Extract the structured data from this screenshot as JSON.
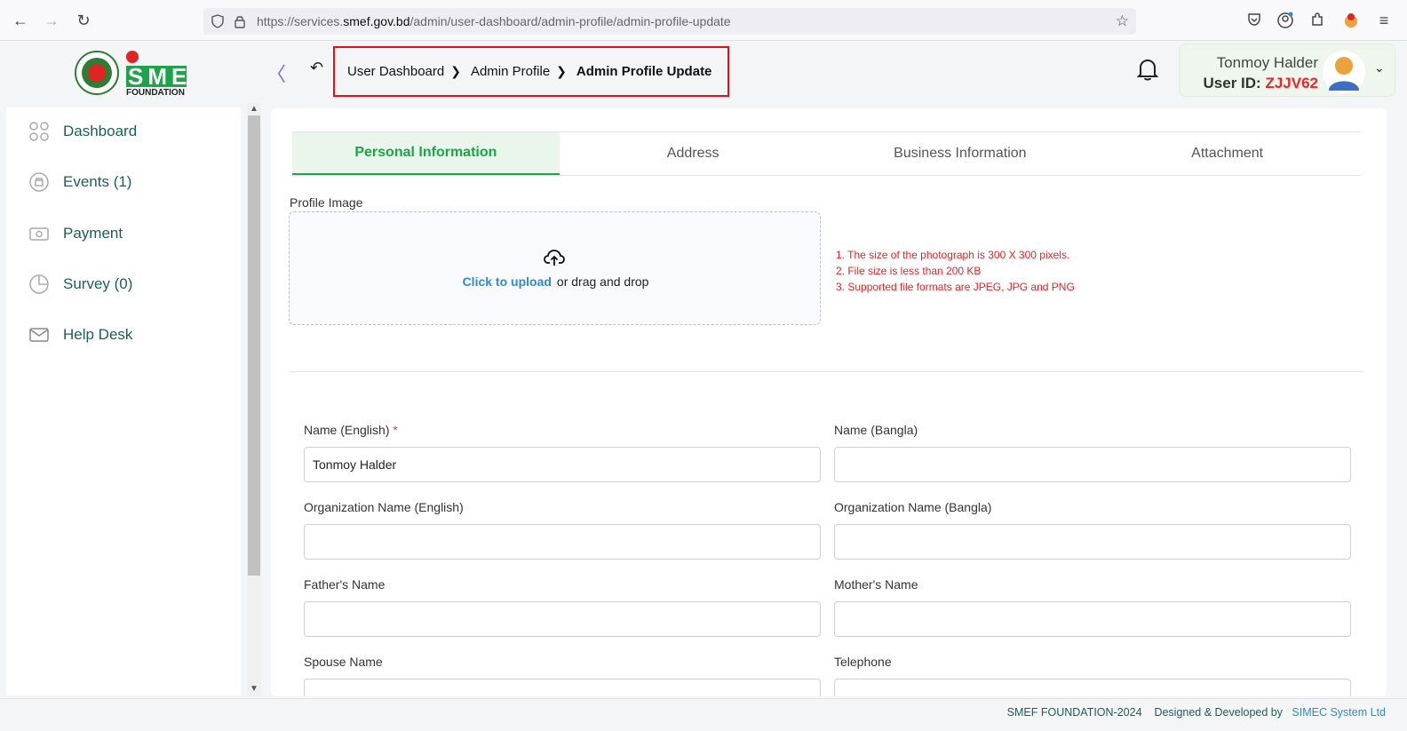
{
  "browser": {
    "url_prefix": "https://services.",
    "url_domain": "smef.gov.bd",
    "url_path": "/admin/user-dashboard/admin-profile/admin-profile-update"
  },
  "header": {
    "logo_text": "FOUNDATION",
    "logo_brand": "SME",
    "breadcrumb": [
      "User Dashboard",
      "Admin Profile",
      "Admin Profile Update"
    ],
    "user_name": "Tonmoy Halder",
    "user_id_label": "User ID:",
    "user_id": "ZJJV62"
  },
  "sidebar": {
    "items": [
      {
        "label": "Dashboard",
        "icon": "grid-icon"
      },
      {
        "label": "Events (1)",
        "icon": "events-icon"
      },
      {
        "label": "Payment",
        "icon": "payment-icon"
      },
      {
        "label": "Survey (0)",
        "icon": "pie-icon"
      },
      {
        "label": "Help Desk",
        "icon": "mail-icon"
      }
    ]
  },
  "tabs": [
    "Personal Information",
    "Address",
    "Business Information",
    "Attachment"
  ],
  "profile_image": {
    "label": "Profile Image",
    "upload_link": "Click to upload",
    "upload_rest": "or drag and drop",
    "rules": [
      "1. The size of the photograph is 300 X 300 pixels.",
      "2. File size is less than 200 KB",
      "3. Supported file formats are JPEG, JPG and PNG"
    ]
  },
  "form": {
    "name_en_label": "Name (English)",
    "name_en_value": "Tonmoy Halder",
    "name_bn_label": "Name (Bangla)",
    "org_en_label": "Organization Name (English)",
    "org_bn_label": "Organization Name (Bangla)",
    "father_label": "Father's Name",
    "mother_label": "Mother's Name",
    "spouse_label": "Spouse Name",
    "telephone_label": "Telephone"
  },
  "footer": {
    "copyright": "SMEF FOUNDATION-2024",
    "designed_by": "Designed & Developed by",
    "developer": "SIMEC System Ltd"
  },
  "colors": {
    "accent_green": "#1ea34a",
    "alert_red": "#e02424",
    "link_blue": "#2d8ad9"
  }
}
